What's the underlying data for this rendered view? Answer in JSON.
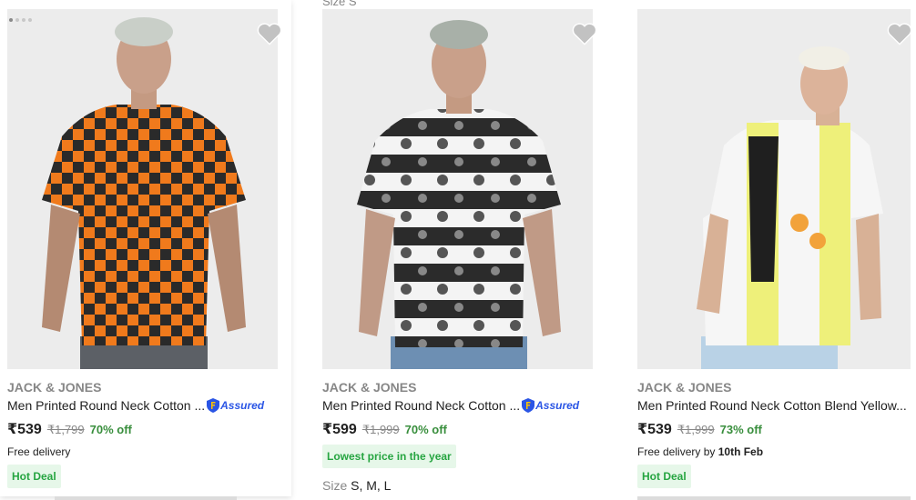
{
  "top_cut": "Size S",
  "products": [
    {
      "brand": "JACK & JONES",
      "title": "Men Printed Round Neck Cotton ...",
      "assured_label": "Assured",
      "price": "₹539",
      "mrp": "₹1,799",
      "discount": "70% off",
      "delivery": "Free delivery",
      "deal_tag": "Hot Deal",
      "image_dots": 4,
      "shirt_color": "#f07a1c"
    },
    {
      "brand": "JACK & JONES",
      "title": "Men Printed Round Neck Cotton ...",
      "assured_label": "Assured",
      "price": "₹599",
      "mrp": "₹1,999",
      "discount": "70% off",
      "deal_tag": "Lowest price in the year",
      "size_label": "Size",
      "size_values": "S, M, L",
      "shirt_color": "#2b2b2b"
    },
    {
      "brand": "JACK & JONES",
      "title": "Men Printed Round Neck Cotton Blend Yellow...",
      "price": "₹539",
      "mrp": "₹1,999",
      "discount": "73% off",
      "delivery_prefix": "Free delivery by",
      "delivery_date": "10th Feb",
      "deal_tag": "Hot Deal",
      "shirt_color": "#eef07a"
    }
  ],
  "colors": {
    "discount": "#388e3c",
    "brand_grey": "#878787",
    "assured_blue": "#2a55e5",
    "tag_bg": "#e6f7e9",
    "tag_text": "#26a541",
    "wishlist_heart": "#c2c2c2"
  }
}
